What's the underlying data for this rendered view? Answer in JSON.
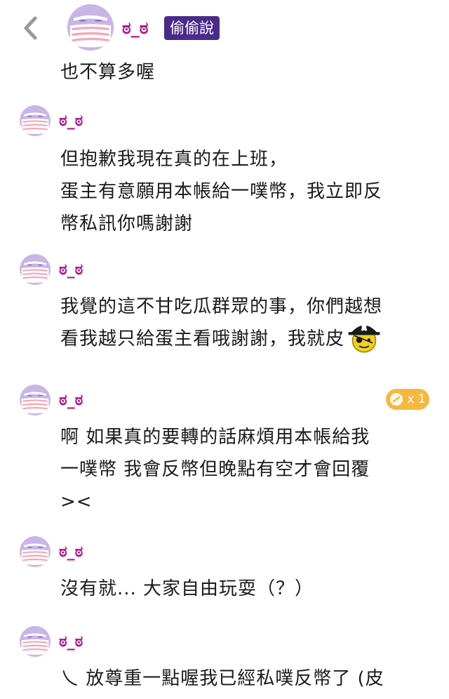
{
  "header": {
    "username": "ಠ_ಠ",
    "badge": "偷偷說",
    "text": "也不算多喔"
  },
  "comments": [
    {
      "username": "ಠ_ಠ",
      "lines": [
        "但抱歉我現在真的在上班，",
        "蛋主有意願用本帳給一噗幣，我立即反",
        "幣私訊你嗎謝謝"
      ]
    },
    {
      "username": "ಠ_ಠ",
      "lines": [
        "我覺的這不甘吃瓜群眾的事，你們越想",
        "看我越只給蛋主看哦謝謝，我就皮"
      ],
      "emoji": "pirate-emoji"
    },
    {
      "username": "ಠ_ಠ",
      "reaction": {
        "icon": "coin-icon",
        "count": "x 1"
      },
      "lines": [
        "啊 如果真的要轉的話麻煩用本帳給我",
        "一噗幣 我會反幣但晚點有空才會回覆",
        "><"
      ]
    },
    {
      "username": "ಠ_ಠ",
      "lines": [
        "沒有就... 大家自由玩耍（？）"
      ]
    },
    {
      "username": "ಠ_ಠ",
      "lines": [
        "乀 放尊重一點喔我已經私噗反幣了 (皮"
      ]
    }
  ],
  "colors": {
    "username": "#b0148f",
    "badge_bg": "#4a2a8a",
    "avatar_bg": "#c9b5e6",
    "mask": "#f5a8b8",
    "reaction_bg": "#f5b940"
  }
}
